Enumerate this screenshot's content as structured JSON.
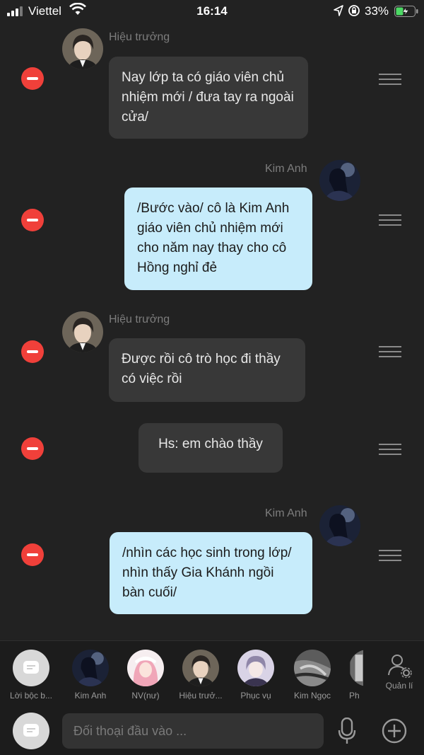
{
  "status_bar": {
    "carrier": "Viettel",
    "time": "16:14",
    "battery_percent": "33%"
  },
  "messages": [
    {
      "side": "left",
      "sender": "Hiệu trưởng",
      "text": "Nay lớp ta có giáo viên chủ nhiệm mới / đưa tay ra ngoài cửa/"
    },
    {
      "side": "right",
      "sender": "Kim Anh",
      "text": "/Bước vào/ cô là Kim Anh giáo viên chủ nhiệm mới cho năm nay thay cho cô Hồng nghỉ đẻ"
    },
    {
      "side": "left",
      "sender": "Hiệu trưởng",
      "text": "Được rồi cô trò học đi thầy có việc rồi"
    },
    {
      "side": "narration",
      "text": "Hs: em chào thầy"
    },
    {
      "side": "right",
      "sender": "Kim Anh",
      "text": "/nhìn các học sinh trong lớp/ nhìn thấy Gia Khánh ngồi bàn cuối/"
    }
  ],
  "characters": [
    {
      "label": "Lời bộc b...",
      "icon": "narration-bubble-icon"
    },
    {
      "label": "Kim Anh",
      "icon": "kim-anh-avatar"
    },
    {
      "label": "NV(nư)",
      "icon": "pink-hair-avatar"
    },
    {
      "label": "Hiệu trưở...",
      "icon": "principal-avatar"
    },
    {
      "label": "Phục vụ",
      "icon": "waiter-avatar"
    },
    {
      "label": "Kim Ngọc",
      "icon": "kim-ngoc-avatar"
    },
    {
      "label": "Ph",
      "icon": "partial-avatar"
    }
  ],
  "manager_label": "Quản lí",
  "input": {
    "placeholder": "Đối thoại đầu vào ..."
  },
  "colors": {
    "background": "#222222",
    "left_bubble": "#383838",
    "right_bubble": "#c7ecfb",
    "remove_button": "#f0403a"
  }
}
